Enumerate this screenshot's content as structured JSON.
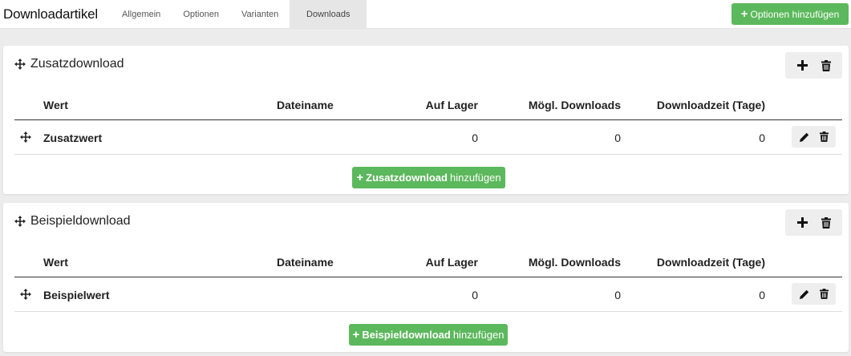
{
  "header": {
    "title": "Downloadartikel",
    "tabs": [
      {
        "label": "Allgemein",
        "active": false
      },
      {
        "label": "Optionen",
        "active": false
      },
      {
        "label": "Varianten",
        "active": false
      },
      {
        "label": "Downloads",
        "active": true
      }
    ],
    "add_options_label": "Optionen hinzufügen"
  },
  "columns": {
    "wert": "Wert",
    "dateiname": "Dateiname",
    "auf_lager": "Auf Lager",
    "moegl_downloads": "Mögl. Downloads",
    "downloadzeit": "Downloadzeit (Tage)"
  },
  "panels": [
    {
      "title": "Zusatzdownload",
      "rows": [
        {
          "wert": "Zusatzwert",
          "dateiname": "",
          "auf_lager": "0",
          "moegl_downloads": "0",
          "downloadzeit": "0"
        }
      ],
      "add_button": {
        "bold": "Zusatzdownload",
        "rest": "hinzufügen"
      }
    },
    {
      "title": "Beispieldownload",
      "rows": [
        {
          "wert": "Beispielwert",
          "dateiname": "",
          "auf_lager": "0",
          "moegl_downloads": "0",
          "downloadzeit": "0"
        }
      ],
      "add_button": {
        "bold": "Beispieldownload",
        "rest": "hinzufügen"
      }
    }
  ],
  "icons": {
    "move": "move-icon",
    "plus": "plus-icon",
    "trash": "trash-icon",
    "edit": "pencil-icon"
  },
  "colors": {
    "accent_green": "#5cb85c",
    "page_bg": "#ececec"
  }
}
